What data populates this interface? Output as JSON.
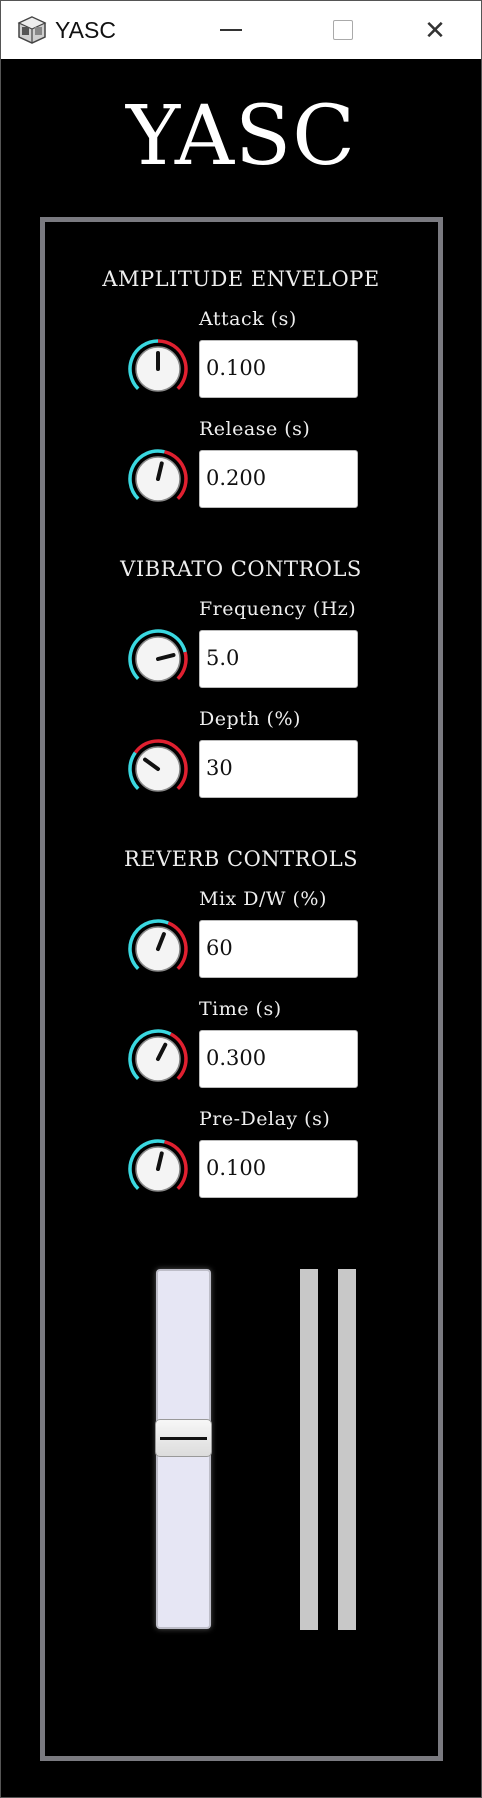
{
  "window": {
    "title": "YASC",
    "app_icon": "cube-icon",
    "minimize_icon": "minimize-icon",
    "maximize_icon": "maximize-icon",
    "close_icon": "close-icon",
    "close_glyph": "✕"
  },
  "app": {
    "heading": "YASC"
  },
  "amplitude": {
    "section_title": "AMPLITUDE ENVELOPE",
    "attack": {
      "label": "Attack (s)",
      "value": "0.100",
      "knob_level": 0.5
    },
    "release": {
      "label": "Release (s)",
      "value": "0.200",
      "knob_level": 0.55
    }
  },
  "vibrato": {
    "section_title": "VIBRATO CONTROLS",
    "frequency": {
      "label": "Frequency (Hz)",
      "value": "5.0",
      "knob_level": 0.78
    },
    "depth": {
      "label": "Depth (%)",
      "value": "30",
      "knob_level": 0.3
    }
  },
  "reverb": {
    "section_title": "REVERB CONTROLS",
    "mix": {
      "label": "Mix D/W (%)",
      "value": "60",
      "knob_level": 0.58
    },
    "time": {
      "label": "Time (s)",
      "value": "0.300",
      "knob_level": 0.6
    },
    "predelay": {
      "label": "Pre-Delay (s)",
      "value": "0.100",
      "knob_level": 0.55
    }
  },
  "volume_slider": {
    "level": 0.5
  },
  "meters": {
    "left_level": 0.0,
    "right_level": 0.0
  },
  "colors": {
    "background": "#000000",
    "panel_border": "#7a7a80",
    "knob_arc_low": "#3ad8e0",
    "knob_arc_high": "#e02030",
    "meter": "#c8c8c8",
    "slider_track": "#e6e6f4"
  }
}
